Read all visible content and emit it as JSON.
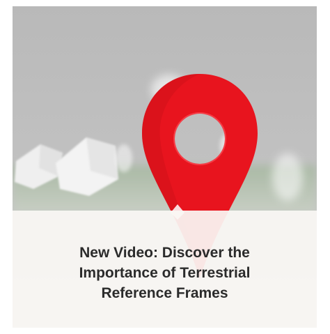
{
  "card": {
    "title": "New Video: Discover the\nImportance of Terrestrial\nReference Frames",
    "thumbnail_icon": "map-pin-icon",
    "pin_color": "#e8141e",
    "panel_color": "#faf8f4"
  }
}
